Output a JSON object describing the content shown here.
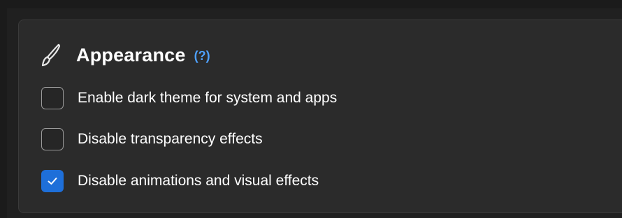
{
  "section": {
    "title": "Appearance",
    "help_label": "(?)",
    "icon": "paintbrush-icon"
  },
  "options": [
    {
      "label": "Enable dark theme for system and apps",
      "checked": false
    },
    {
      "label": "Disable transparency effects",
      "checked": false
    },
    {
      "label": "Disable animations and visual effects",
      "checked": true
    }
  ],
  "colors": {
    "accent": "#1e6fd9",
    "help_link": "#4ea1ff",
    "card_background": "#2b2b2b",
    "text": "#ffffff"
  }
}
